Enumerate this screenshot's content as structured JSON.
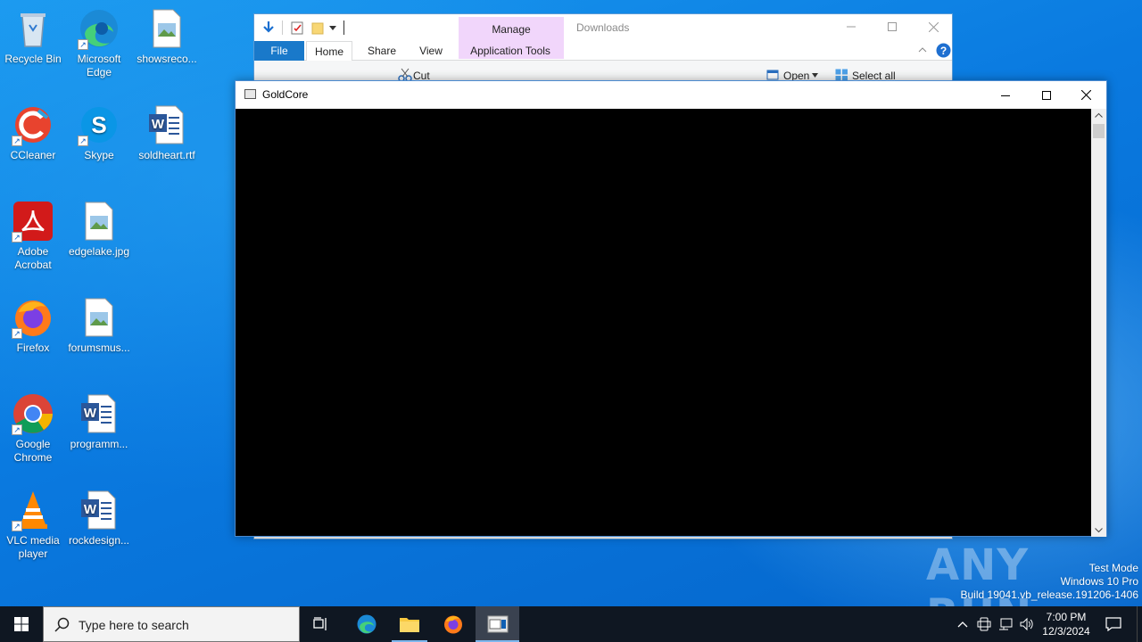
{
  "desktop": {
    "icons": [
      {
        "label": "Recycle Bin",
        "icon": "recycle-bin-icon"
      },
      {
        "label": "Microsoft Edge",
        "icon": "edge-icon"
      },
      {
        "label": "showsreco...",
        "icon": "image-file-icon"
      },
      {
        "label": "CCleaner",
        "icon": "ccleaner-icon"
      },
      {
        "label": "Skype",
        "icon": "skype-icon"
      },
      {
        "label": "soldheart.rtf",
        "icon": "word-doc-icon"
      },
      {
        "label": "Adobe Acrobat",
        "icon": "acrobat-icon"
      },
      {
        "label": "edgelake.jpg",
        "icon": "image-file-icon"
      },
      {
        "label": "Firefox",
        "icon": "firefox-icon"
      },
      {
        "label": "forumsmus...",
        "icon": "image-file-icon"
      },
      {
        "label": "Google Chrome",
        "icon": "chrome-icon"
      },
      {
        "label": "programm...",
        "icon": "word-doc-icon"
      },
      {
        "label": "VLC media player",
        "icon": "vlc-icon"
      },
      {
        "label": "rockdesign...",
        "icon": "word-doc-icon"
      }
    ]
  },
  "explorer": {
    "title": "Downloads",
    "context_tab": "Manage",
    "tabs": [
      "File",
      "Home",
      "Share",
      "View",
      "Application Tools"
    ],
    "ribbon": {
      "cut": "Cut",
      "open": "Open",
      "select_all": "Select all"
    }
  },
  "goldcore": {
    "title": "GoldCore"
  },
  "watermark": {
    "mode": "Test Mode",
    "edition": "Windows 10 Pro",
    "build": "Build 19041.vb_release.191206-1406",
    "brand": "ANY RUN"
  },
  "taskbar": {
    "search_placeholder": "Type here to search",
    "time": "7:00 PM",
    "date": "12/3/2024"
  },
  "colors": {
    "desktop": "#0a74d8",
    "taskbar": "#0f1722",
    "accent": "#0078d7",
    "manage_tab": "#f1d6fb"
  }
}
